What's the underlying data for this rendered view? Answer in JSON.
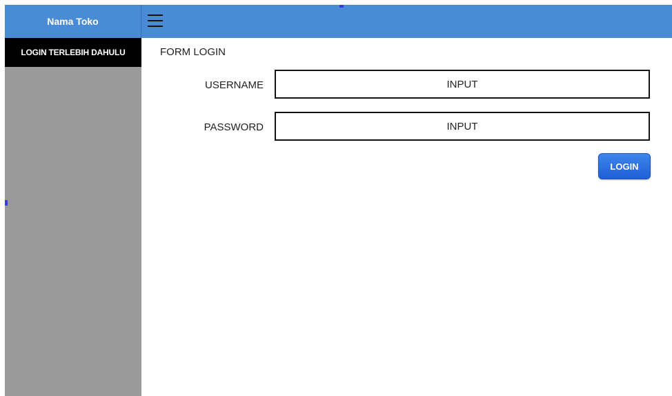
{
  "sidebar": {
    "brand": "Nama Toko",
    "items": [
      {
        "label": "LOGIN TERLEBIH DAHULU"
      }
    ]
  },
  "topbar": {
    "menu_icon": "hamburger-menu-icon"
  },
  "form": {
    "title": "FORM LOGIN",
    "username": {
      "label": "USERNAME",
      "placeholder": "INPUT"
    },
    "password": {
      "label": "PASSWORD",
      "placeholder": "INPUT"
    },
    "submit_label": "LOGIN"
  },
  "colors": {
    "header_blue": "#4a8bd6",
    "sidebar_gray": "#9a9a9a",
    "active_item": "#000000",
    "button_blue": "#2f72e2"
  }
}
